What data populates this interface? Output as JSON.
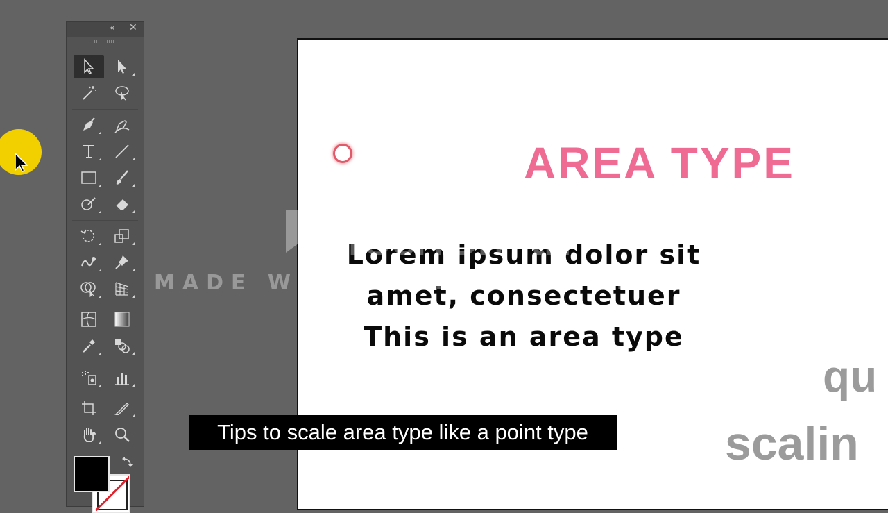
{
  "artboard": {
    "title": "AREA TYPE",
    "body_lines": [
      "Lorem ipsum dolor sit",
      "amet, consectetuer",
      "This is an area type"
    ],
    "side_fragments": [
      "qu",
      "scalin"
    ],
    "title_color": "#ef6b93"
  },
  "tools_panel": {
    "collapse_glyph": "«",
    "close_glyph": "✕",
    "tools": [
      {
        "name": "selection-tool",
        "icon": "selection-arrow-icon"
      },
      {
        "name": "direct-selection-tool",
        "icon": "direct-selection-arrow-icon"
      },
      {
        "name": "magic-wand-tool",
        "icon": "magic-wand-icon"
      },
      {
        "name": "lasso-tool",
        "icon": "lasso-icon"
      },
      {
        "name": "pen-tool",
        "icon": "pen-icon"
      },
      {
        "name": "curvature-tool",
        "icon": "curvature-pen-icon"
      },
      {
        "name": "type-tool",
        "icon": "type-icon"
      },
      {
        "name": "line-segment-tool",
        "icon": "line-icon"
      },
      {
        "name": "rectangle-tool",
        "icon": "rectangle-icon"
      },
      {
        "name": "paintbrush-tool",
        "icon": "paintbrush-icon"
      },
      {
        "name": "shaper-tool",
        "icon": "shaper-icon"
      },
      {
        "name": "eraser-tool",
        "icon": "eraser-icon"
      },
      {
        "name": "rotate-tool",
        "icon": "rotate-icon"
      },
      {
        "name": "scale-tool",
        "icon": "scale-icon"
      },
      {
        "name": "warp-tool",
        "icon": "warp-icon"
      },
      {
        "name": "puppet-warp-tool",
        "icon": "pin-icon"
      },
      {
        "name": "shape-builder-tool",
        "icon": "shape-builder-icon"
      },
      {
        "name": "perspective-grid-tool",
        "icon": "perspective-grid-icon"
      },
      {
        "name": "mesh-tool",
        "icon": "mesh-icon"
      },
      {
        "name": "gradient-tool",
        "icon": "gradient-icon"
      },
      {
        "name": "eyedropper-tool",
        "icon": "eyedropper-icon"
      },
      {
        "name": "blend-tool",
        "icon": "blend-icon"
      },
      {
        "name": "symbol-sprayer-tool",
        "icon": "symbol-sprayer-icon"
      },
      {
        "name": "graph-tool",
        "icon": "column-graph-icon"
      },
      {
        "name": "artboard-tool",
        "icon": "artboard-icon"
      },
      {
        "name": "slice-tool",
        "icon": "slice-icon"
      },
      {
        "name": "hand-tool",
        "icon": "hand-icon"
      },
      {
        "name": "zoom-tool",
        "icon": "zoom-icon"
      }
    ],
    "fill_color": "#000000",
    "stroke_color": "none"
  },
  "watermark": {
    "logo": "TechSmith",
    "line": "MADE WITH CAMTASIA FREE TRIAL"
  },
  "caption": {
    "text": "Tips to scale area type like a point type"
  }
}
